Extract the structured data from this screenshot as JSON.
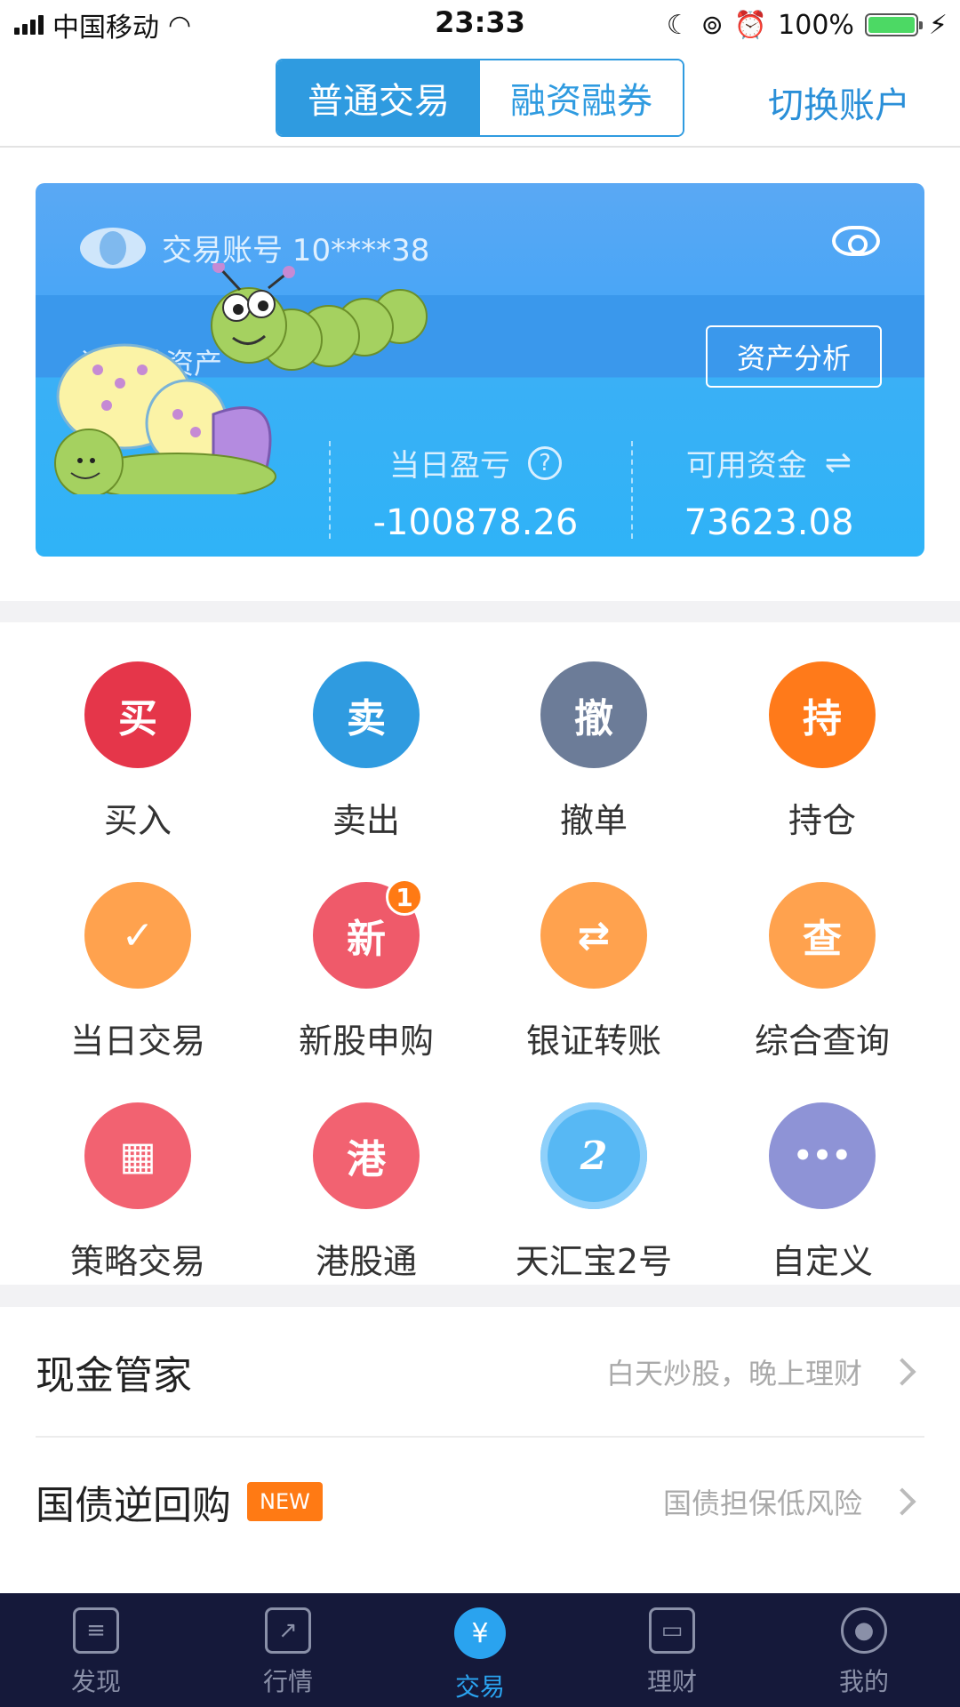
{
  "status_bar": {
    "carrier": "中国移动",
    "time": "23:33",
    "battery": "100%"
  },
  "header": {
    "segments": [
      {
        "label": "普通交易",
        "active": true
      },
      {
        "label": "融资融券",
        "active": false
      }
    ],
    "switch_account": "切换账户"
  },
  "account_card": {
    "account_label": "交易账号 10****38",
    "total_assets_label": "证券总资产",
    "analysis_button": "资产分析",
    "daily_pnl_label": "当日盈亏",
    "daily_pnl_value": "-100878.26",
    "available_label": "可用资金",
    "available_value": "73623.08"
  },
  "grid": [
    {
      "label": "买入",
      "glyph": "买",
      "color": "#e5364a"
    },
    {
      "label": "卖出",
      "glyph": "卖",
      "color": "#2f9be0"
    },
    {
      "label": "撤单",
      "glyph": "撤",
      "color": "#6c7c98"
    },
    {
      "label": "持仓",
      "glyph": "持",
      "color": "#ff7a1a"
    },
    {
      "label": "当日交易",
      "glyph": "✓",
      "color": "#ffa24e"
    },
    {
      "label": "新股申购",
      "glyph": "新",
      "color": "#ef5a6a",
      "badge": "1"
    },
    {
      "label": "银证转账",
      "glyph": "⇄",
      "color": "#ffa24e"
    },
    {
      "label": "综合查询",
      "glyph": "查",
      "color": "#ffa24e"
    },
    {
      "label": "策略交易",
      "glyph": "▦",
      "color": "#f26271"
    },
    {
      "label": "港股通",
      "glyph": "港",
      "color": "#f26271"
    },
    {
      "label": "天汇宝2号",
      "glyph": "2",
      "color": "#57b8f4"
    },
    {
      "label": "自定义",
      "glyph": "•••",
      "color": "#8e93d6"
    }
  ],
  "list": [
    {
      "title": "现金管家",
      "subtitle": "白天炒股，晚上理财",
      "tag": ""
    },
    {
      "title": "国债逆回购",
      "subtitle": "国债担保低风险",
      "tag": "NEW"
    }
  ],
  "tabbar": [
    {
      "label": "发现",
      "icon": "news-icon",
      "glyph": "≡",
      "active": false
    },
    {
      "label": "行情",
      "icon": "chart-icon",
      "glyph": "↗",
      "active": false
    },
    {
      "label": "交易",
      "icon": "yen-icon",
      "glyph": "¥",
      "active": true
    },
    {
      "label": "理财",
      "icon": "wallet-icon",
      "glyph": "▭",
      "active": false
    },
    {
      "label": "我的",
      "icon": "user-icon",
      "glyph": "●",
      "active": false
    }
  ]
}
